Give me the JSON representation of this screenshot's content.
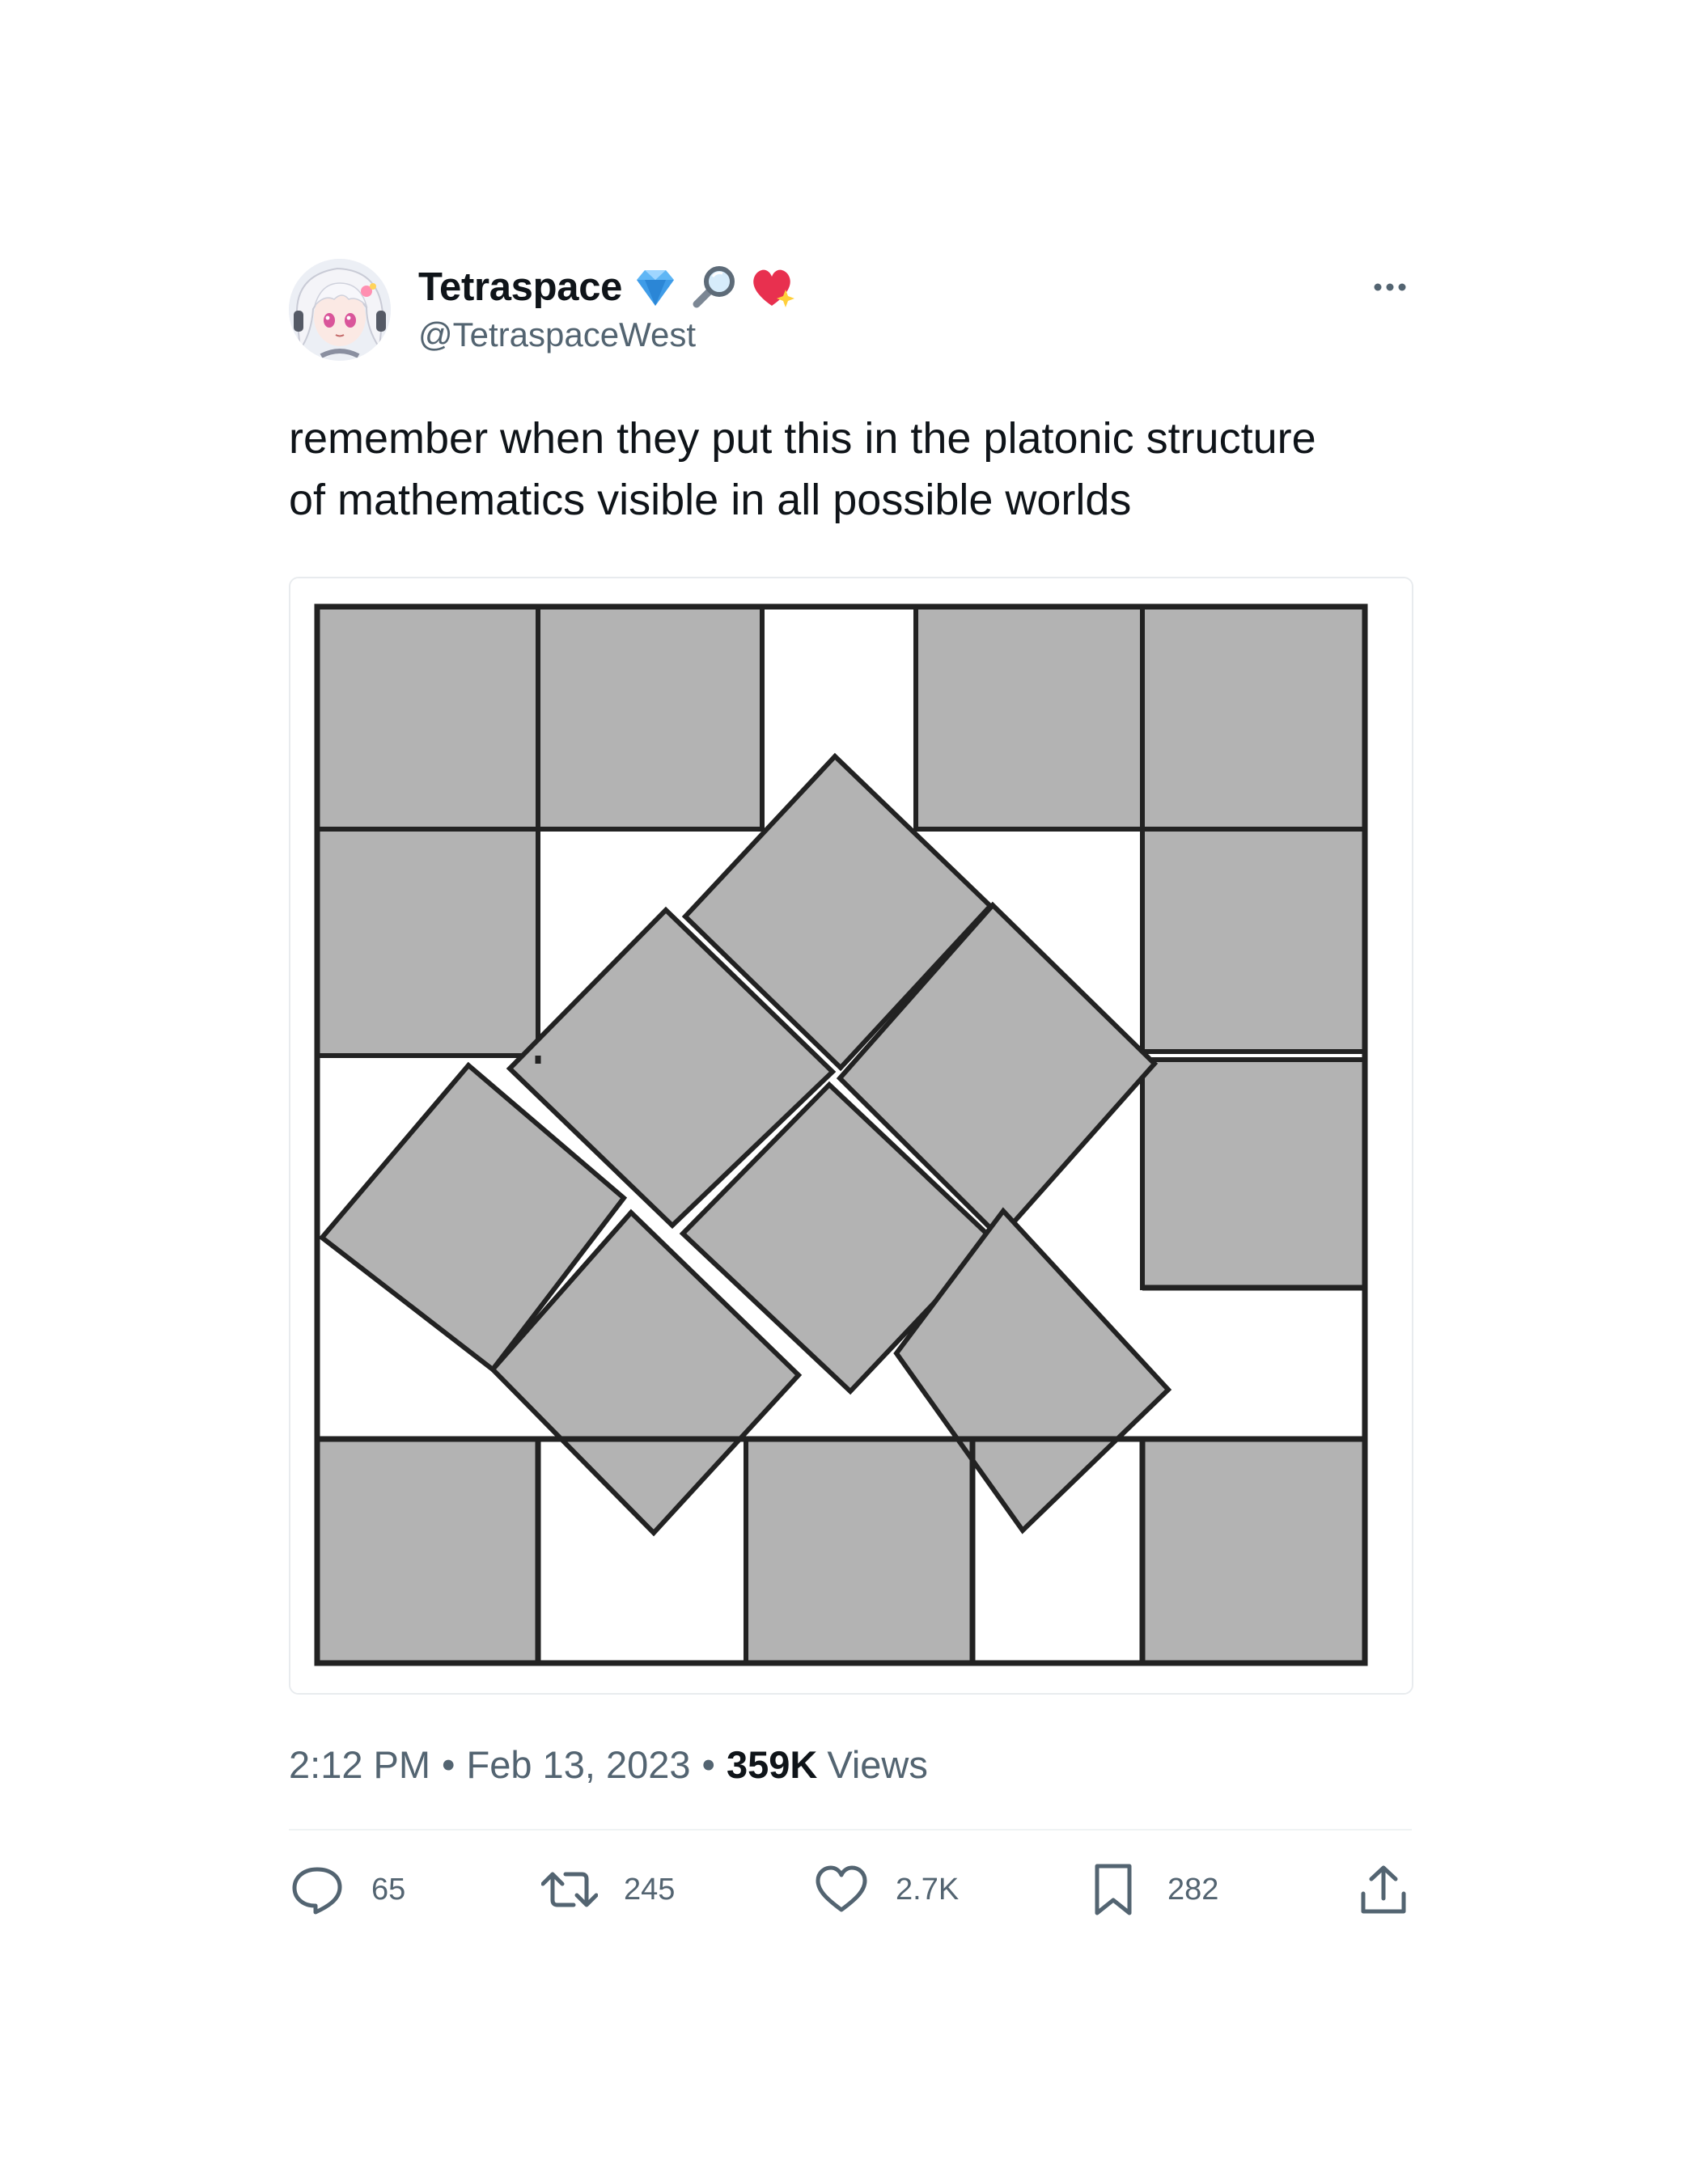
{
  "author": {
    "display_name": "Tetraspace",
    "handle": "@TetraspaceWest",
    "emoji_icons": [
      "diamond-icon",
      "magnifying-glass-icon",
      "sparkling-heart-icon"
    ],
    "avatar_icon": "anime-avatar-icon"
  },
  "tweet": {
    "text": "remember when they put this in the platonic structure\nof mathematics visible in all possible worlds"
  },
  "meta": {
    "time": "2:12 PM",
    "separator": "•",
    "date": "Feb 13, 2023",
    "views_count": "359K",
    "views_label": "Views"
  },
  "actions": {
    "replies": "65",
    "retweets": "245",
    "likes": "2.7K",
    "bookmarks": "282"
  },
  "colors": {
    "text_primary": "#0f1419",
    "text_secondary": "#536471",
    "square_fill": "#b3b3b3",
    "square_stroke": "#222222"
  }
}
